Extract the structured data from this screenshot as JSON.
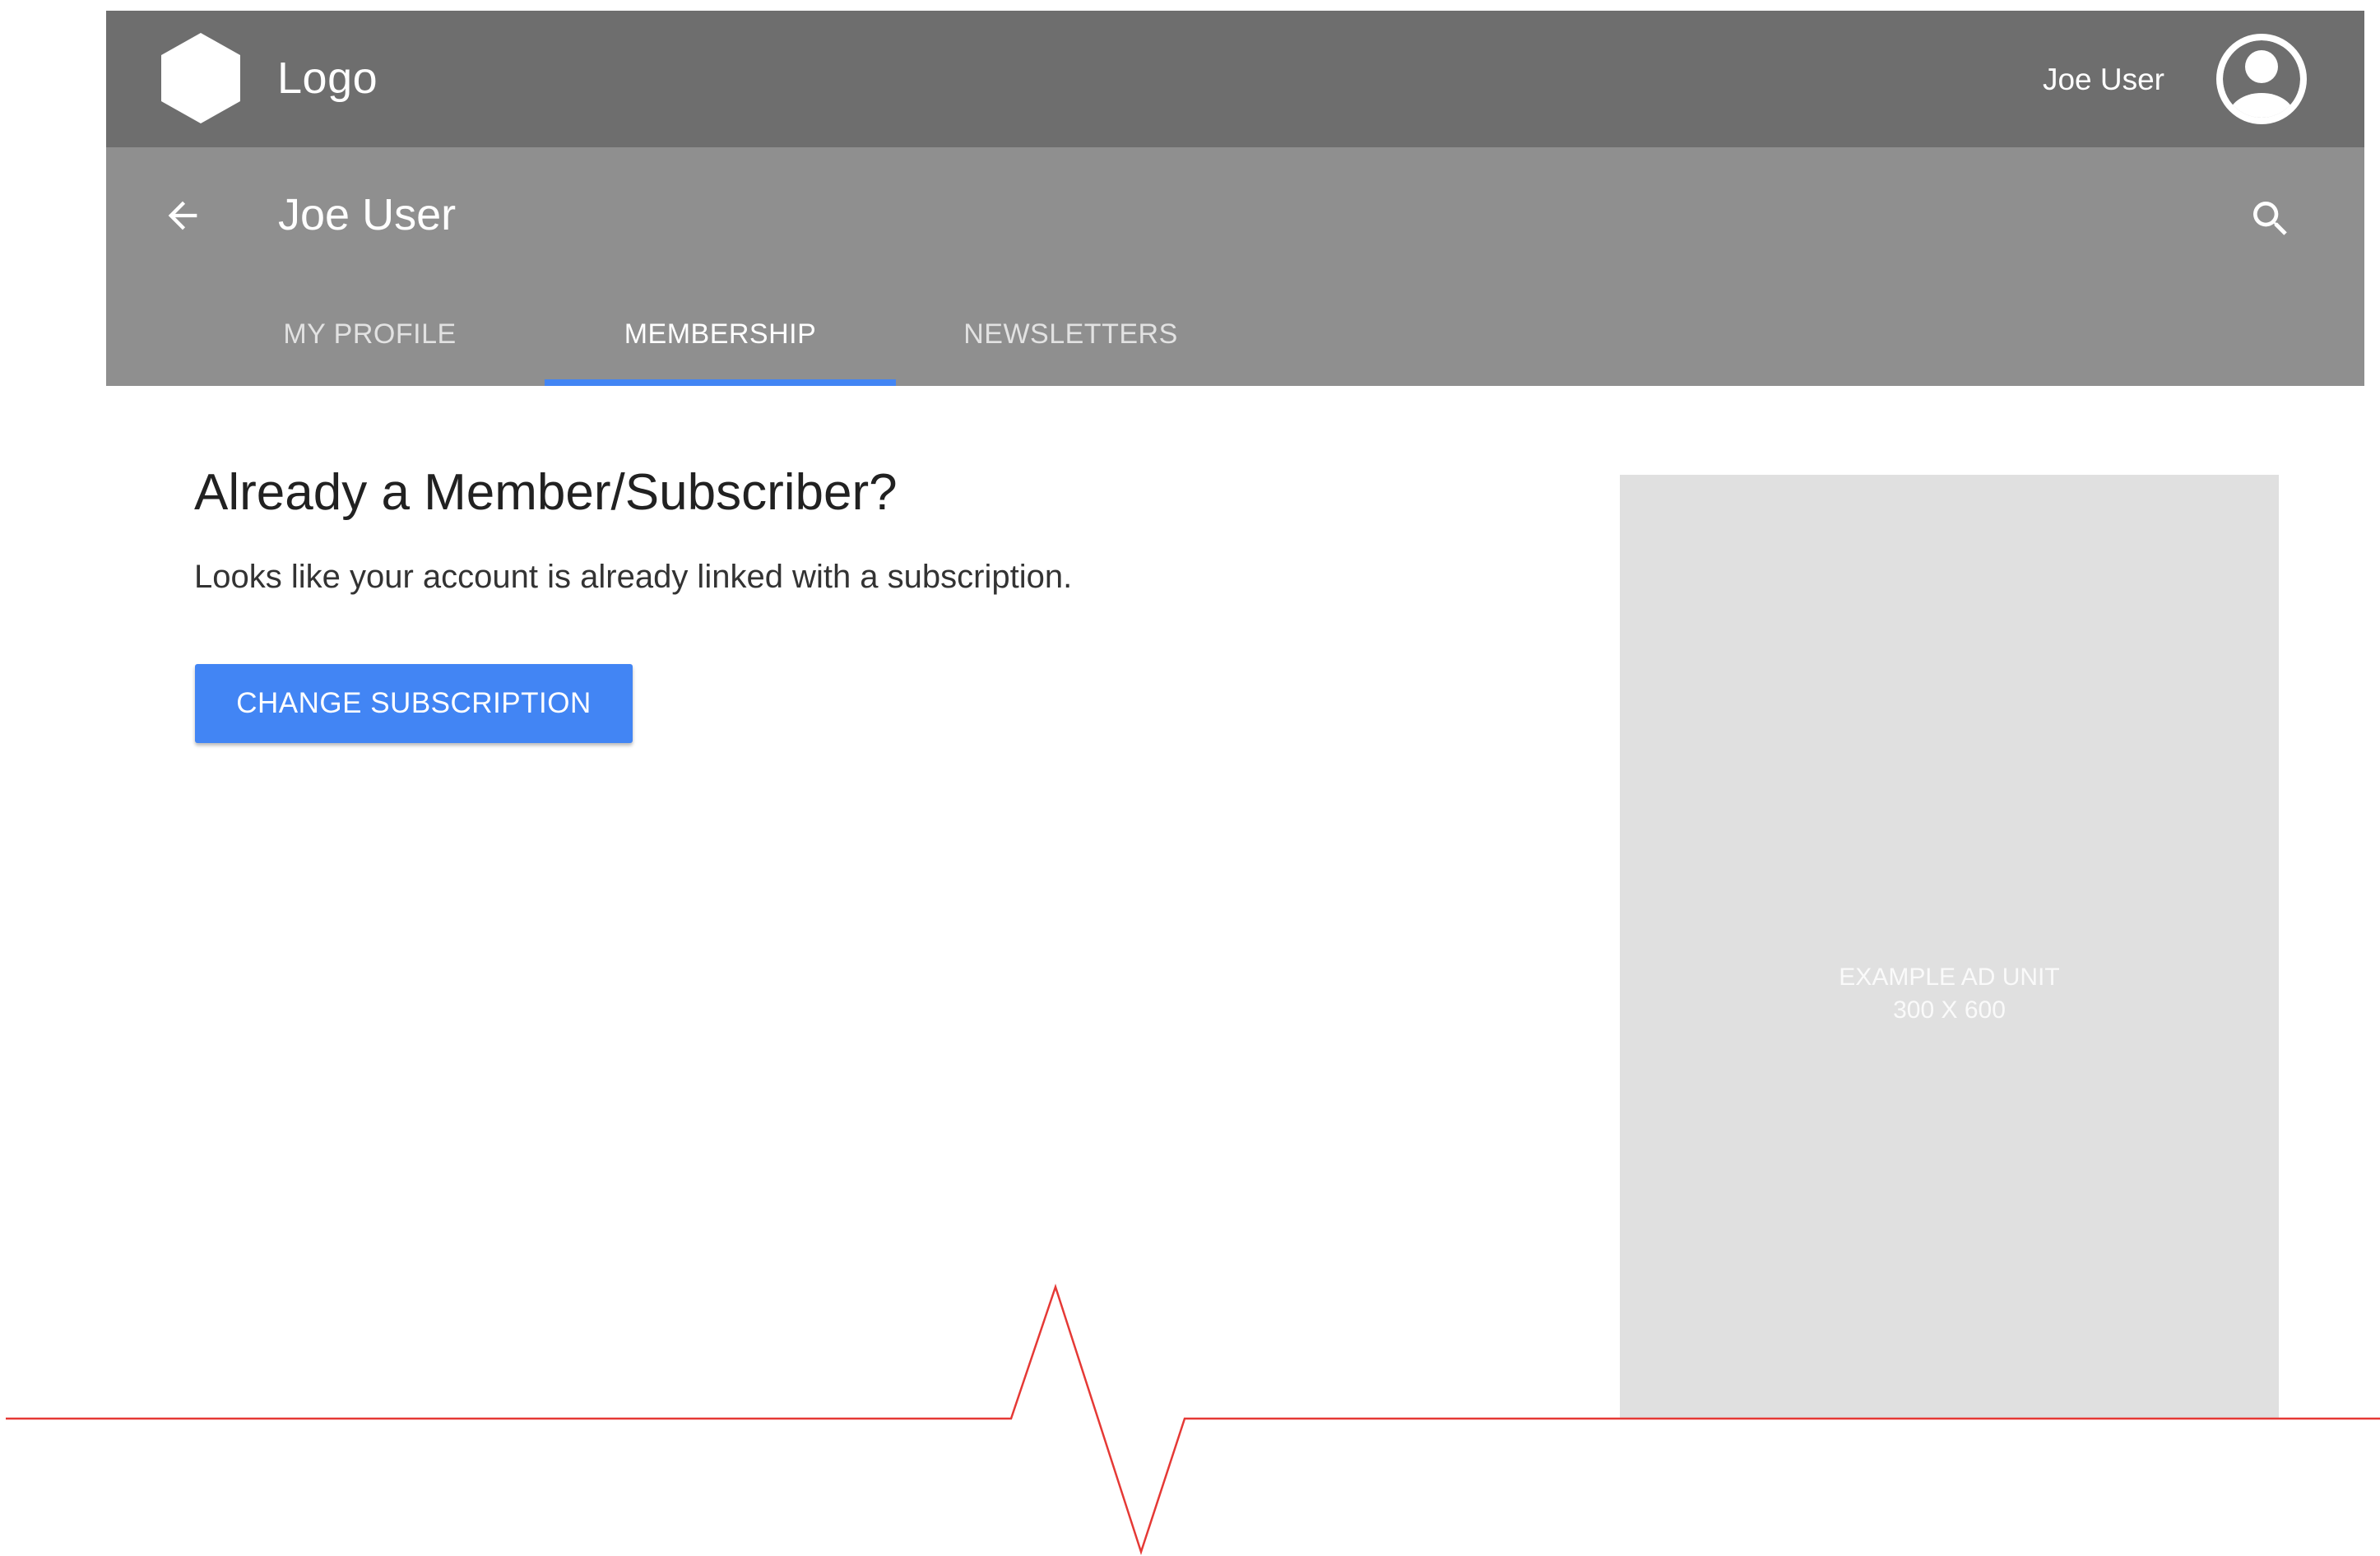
{
  "header": {
    "logo_text": "Logo",
    "logo_icon": "hexagon-logo-icon",
    "user_name": "Joe User",
    "avatar_icon": "account-circle-icon"
  },
  "subheader": {
    "back_icon": "arrow-back-icon",
    "title": "Joe User",
    "search_icon": "search-icon"
  },
  "tabs": [
    {
      "label": "MY PROFILE",
      "active": false
    },
    {
      "label": "MEMBERSHIP",
      "active": true
    },
    {
      "label": "NEWSLETTERS",
      "active": false
    }
  ],
  "content": {
    "heading": "Already a Member/Subscriber?",
    "message": "Looks like your account is already linked with a subscription.",
    "button_label": "CHANGE SUBSCRIPTION"
  },
  "ad": {
    "line1": "EXAMPLE AD UNIT",
    "line2": "300 X 600"
  },
  "colors": {
    "appbar": "#6e6e6e",
    "subbar": "#8f8f8f",
    "accent": "#4285f4",
    "ad_bg": "#e0e0e0",
    "fold_line": "#e53935"
  }
}
